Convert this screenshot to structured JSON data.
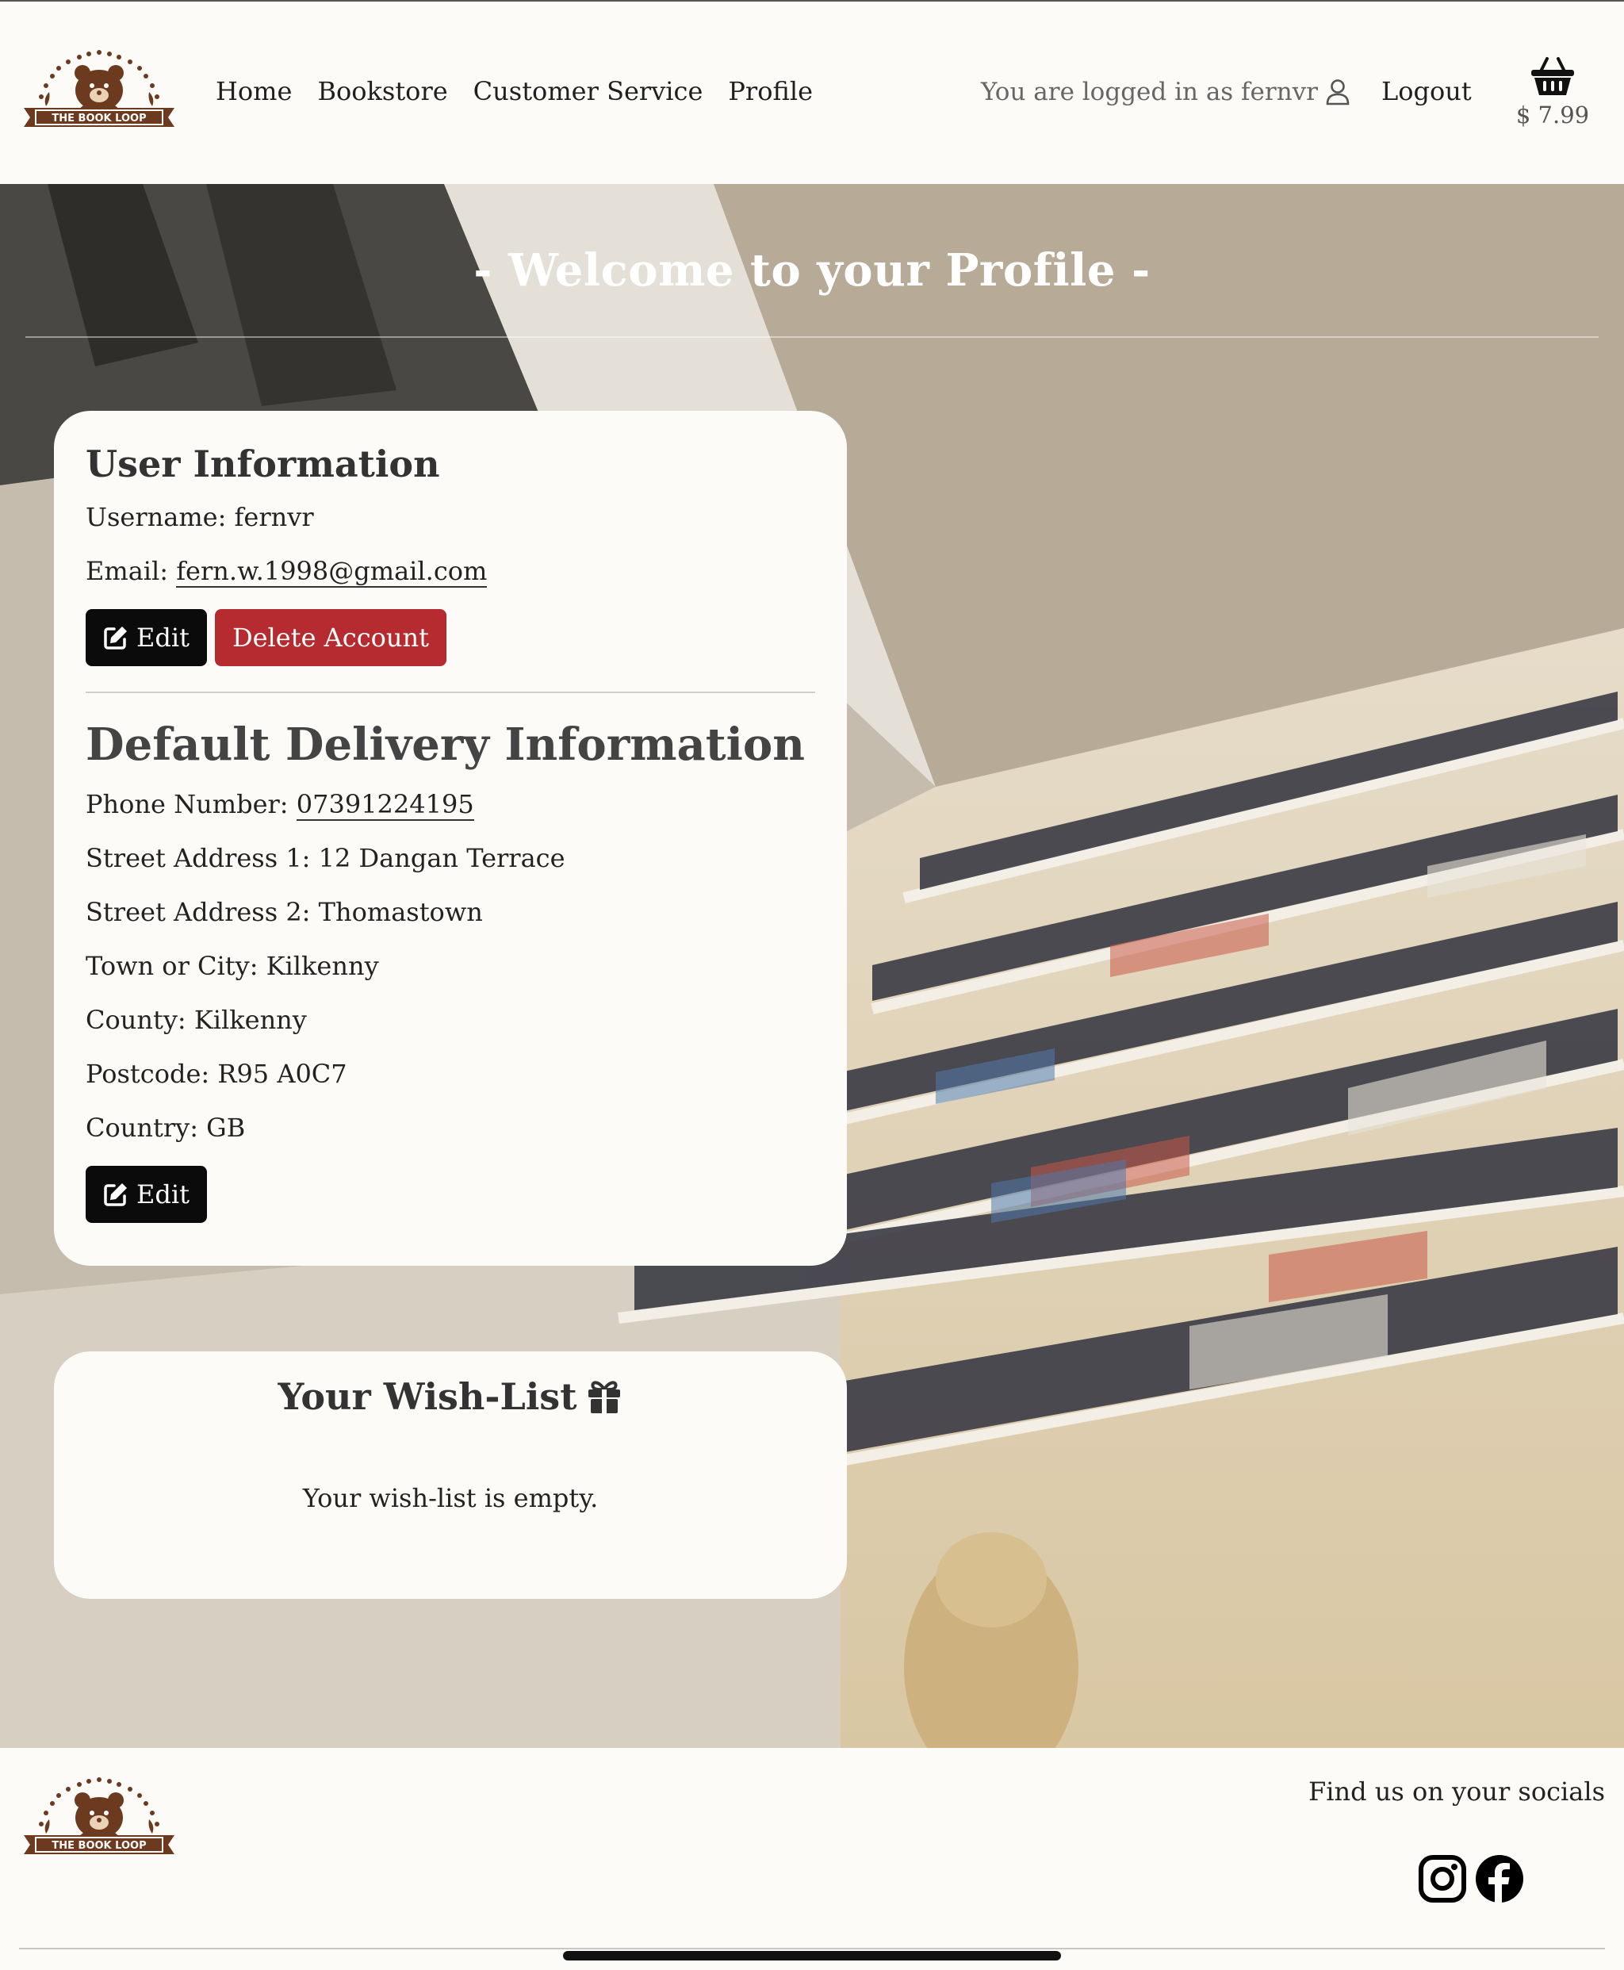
{
  "brand": {
    "logo_text": "THE BOOK LOOP"
  },
  "nav": {
    "items": [
      {
        "label": "Home"
      },
      {
        "label": "Bookstore"
      },
      {
        "label": "Customer Service"
      },
      {
        "label": "Profile"
      }
    ]
  },
  "account": {
    "status_text": "You are logged in as fernvr",
    "user_icon": "user-icon",
    "logout_label": "Logout"
  },
  "basket": {
    "icon": "basket-icon",
    "total": "$ 7.99"
  },
  "hero": {
    "title": "- Welcome to your Profile -"
  },
  "user_info": {
    "heading": "User Information",
    "username_label": "Username:",
    "username": "fernvr",
    "email_label": "Email:",
    "email": "fern.w.1998@gmail.com",
    "edit_label": "Edit",
    "delete_label": "Delete Account"
  },
  "delivery": {
    "heading": "Default Delivery Information",
    "phone_label": "Phone Number:",
    "phone": "07391224195",
    "street1": "Street Address 1: 12 Dangan Terrace",
    "street2": "Street Address 2: Thomastown",
    "town": "Town or City: Kilkenny",
    "county": "County: Kilkenny",
    "postcode": "Postcode: R95 A0C7",
    "country": "Country: GB",
    "edit_label": "Edit"
  },
  "wishlist": {
    "heading": "Your Wish-List",
    "icon": "gift-icon",
    "empty_text": "Your wish-list is empty."
  },
  "footer": {
    "socials_title": "Find us on your socials",
    "socials": [
      "instagram-icon",
      "facebook-icon"
    ]
  },
  "colors": {
    "page_bg": "#fcfbf8",
    "button_dark": "#0b0b0b",
    "button_danger": "#b52b30",
    "brand_brown": "#6b3a1f"
  }
}
